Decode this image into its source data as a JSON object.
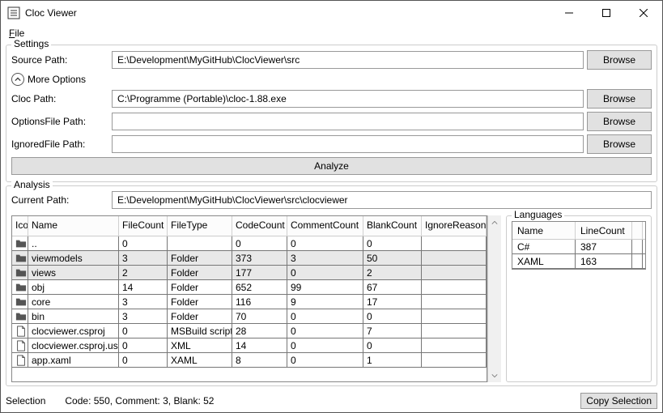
{
  "window": {
    "title": "Cloc Viewer"
  },
  "menu": {
    "file_label": "File"
  },
  "settings": {
    "legend": "Settings",
    "source_label": "Source Path:",
    "source_value": "E:\\Development\\MyGitHub\\ClocViewer\\src",
    "browse": "Browse",
    "more_label": "More Options",
    "cloc_label": "Cloc Path:",
    "cloc_value": "C:\\Programme (Portable)\\cloc-1.88.exe",
    "options_label": "OptionsFile Path:",
    "options_value": "",
    "ignored_label": "IgnoredFile Path:",
    "ignored_value": "",
    "analyze": "Analyze"
  },
  "analysis": {
    "legend": "Analysis",
    "current_label": "Current Path:",
    "current_value": "E:\\Development\\MyGitHub\\ClocViewer\\src\\clocviewer"
  },
  "grid": {
    "headers": {
      "icon": "Ico",
      "name": "Name",
      "filecount": "FileCount",
      "filetype": "FileType",
      "code": "CodeCount",
      "comment": "CommentCount",
      "blank": "BlankCount",
      "ignore": "IgnoreReason"
    },
    "rows": [
      {
        "icon": "folder",
        "name": "..",
        "fc": "0",
        "ft": "",
        "code": "0",
        "com": "0",
        "blank": "0",
        "ign": "",
        "sel": false
      },
      {
        "icon": "folder",
        "name": "viewmodels",
        "fc": "3",
        "ft": "Folder",
        "code": "373",
        "com": "3",
        "blank": "50",
        "ign": "",
        "sel": true
      },
      {
        "icon": "folder",
        "name": "views",
        "fc": "2",
        "ft": "Folder",
        "code": "177",
        "com": "0",
        "blank": "2",
        "ign": "",
        "sel": true
      },
      {
        "icon": "folder",
        "name": "obj",
        "fc": "14",
        "ft": "Folder",
        "code": "652",
        "com": "99",
        "blank": "67",
        "ign": "",
        "sel": false
      },
      {
        "icon": "folder",
        "name": "core",
        "fc": "3",
        "ft": "Folder",
        "code": "116",
        "com": "9",
        "blank": "17",
        "ign": "",
        "sel": false
      },
      {
        "icon": "folder",
        "name": "bin",
        "fc": "3",
        "ft": "Folder",
        "code": "70",
        "com": "0",
        "blank": "0",
        "ign": "",
        "sel": false
      },
      {
        "icon": "file",
        "name": "clocviewer.csproj",
        "fc": "0",
        "ft": "MSBuild script",
        "code": "28",
        "com": "0",
        "blank": "7",
        "ign": "",
        "sel": false
      },
      {
        "icon": "file",
        "name": "clocviewer.csproj.us",
        "fc": "0",
        "ft": "XML",
        "code": "14",
        "com": "0",
        "blank": "0",
        "ign": "",
        "sel": false
      },
      {
        "icon": "file",
        "name": "app.xaml",
        "fc": "0",
        "ft": "XAML",
        "code": "8",
        "com": "0",
        "blank": "1",
        "ign": "",
        "sel": false
      }
    ]
  },
  "languages": {
    "legend": "Languages",
    "headers": {
      "name": "Name",
      "linecount": "LineCount"
    },
    "rows": [
      {
        "name": "C#",
        "lc": "387"
      },
      {
        "name": "XAML",
        "lc": "163"
      }
    ]
  },
  "status": {
    "selection_label": "Selection",
    "summary": "Code: 550, Comment: 3, Blank: 52",
    "copy": "Copy Selection"
  }
}
